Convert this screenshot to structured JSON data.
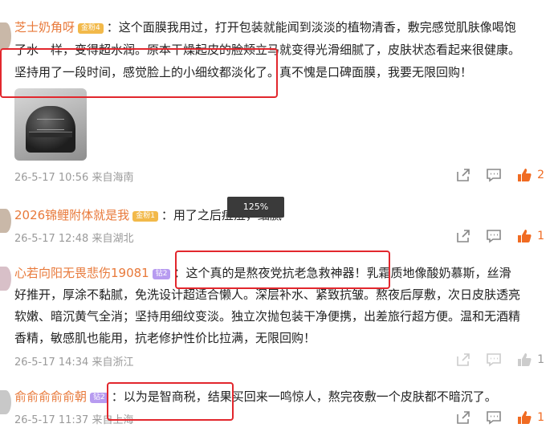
{
  "zoom_label": "125%",
  "colors": {
    "accent_like": "#f06b22",
    "username": "#e8793a",
    "highlight_box": "#e2272d"
  },
  "comments": [
    {
      "username": "芝士奶角呀",
      "badge": "金粉4",
      "lines": [
        "：这个面膜我用过，打开包装就能闻到淡淡的植物清香，敷完感觉肌肤像喝饱",
        "了水一样，变得超水润。原本干燥起皮的脸颊立马就变得光滑细腻了，皮肤状态看起来很健康。",
        "坚持用了一段时间，感觉脸上的小细纹都淡化了。真不愧是口碑面膜，我要无限回购！"
      ],
      "time": "26-5-17 10:56",
      "location": "来自海南",
      "likes": "2"
    },
    {
      "username": "2026锦鲤附体就是我",
      "badge": "金粉1",
      "lines": [
        "：用了之后痘痘，细腻"
      ],
      "time": "26-5-17 12:48",
      "location": "来自湖北",
      "likes": "1"
    },
    {
      "username": "心若向阳无畏悲伤19081",
      "badge": "钻2",
      "lines": [
        "：这个真的是熬夜党抗老急救神器！乳霜质地像酸奶慕斯，丝滑",
        "好推开，厚涂不黏腻，免洗设计超适合懒人。深层补水、紧致抗皱。熬夜后厚敷，次日皮肤透亮",
        "软嫩、暗沉黄气全消；坚持用细纹变淡。独立次抛包装干净便携，出差旅行超方便。温和无酒精",
        "香精，敏感肌也能用，抗老修护性价比拉满，无限回购！"
      ],
      "time": "26-5-17 14:34",
      "location": "来自浙江",
      "likes": "1"
    },
    {
      "username": "俞俞俞俞俞朝",
      "badge": "钻2",
      "lines": [
        "：以为是智商税，结果买回来一鸣惊人，熬完夜敷一个皮肤都不暗沉了。"
      ],
      "time": "26-5-17 11:37",
      "location": "来自上海",
      "likes": "1"
    }
  ]
}
